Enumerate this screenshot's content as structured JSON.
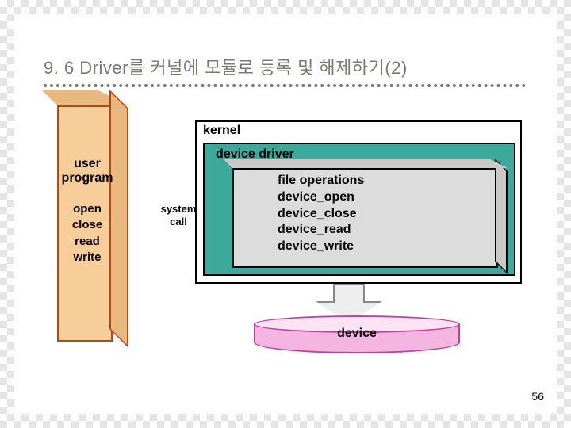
{
  "title": "9. 6  Driver를 커널에 모듈로 등록 및 해제하기(2)",
  "user": {
    "heading": "user\nprogram",
    "ops": [
      "open",
      "close",
      "read",
      "write"
    ]
  },
  "syscall": "system\ncall",
  "kernel": {
    "label": "kernel"
  },
  "driver": {
    "label": "device driver"
  },
  "fops": {
    "heading": "file operations",
    "items": [
      "device_open",
      "device_close",
      "device_read",
      "device_write"
    ]
  },
  "device": {
    "label": "device"
  },
  "page_number": "56"
}
